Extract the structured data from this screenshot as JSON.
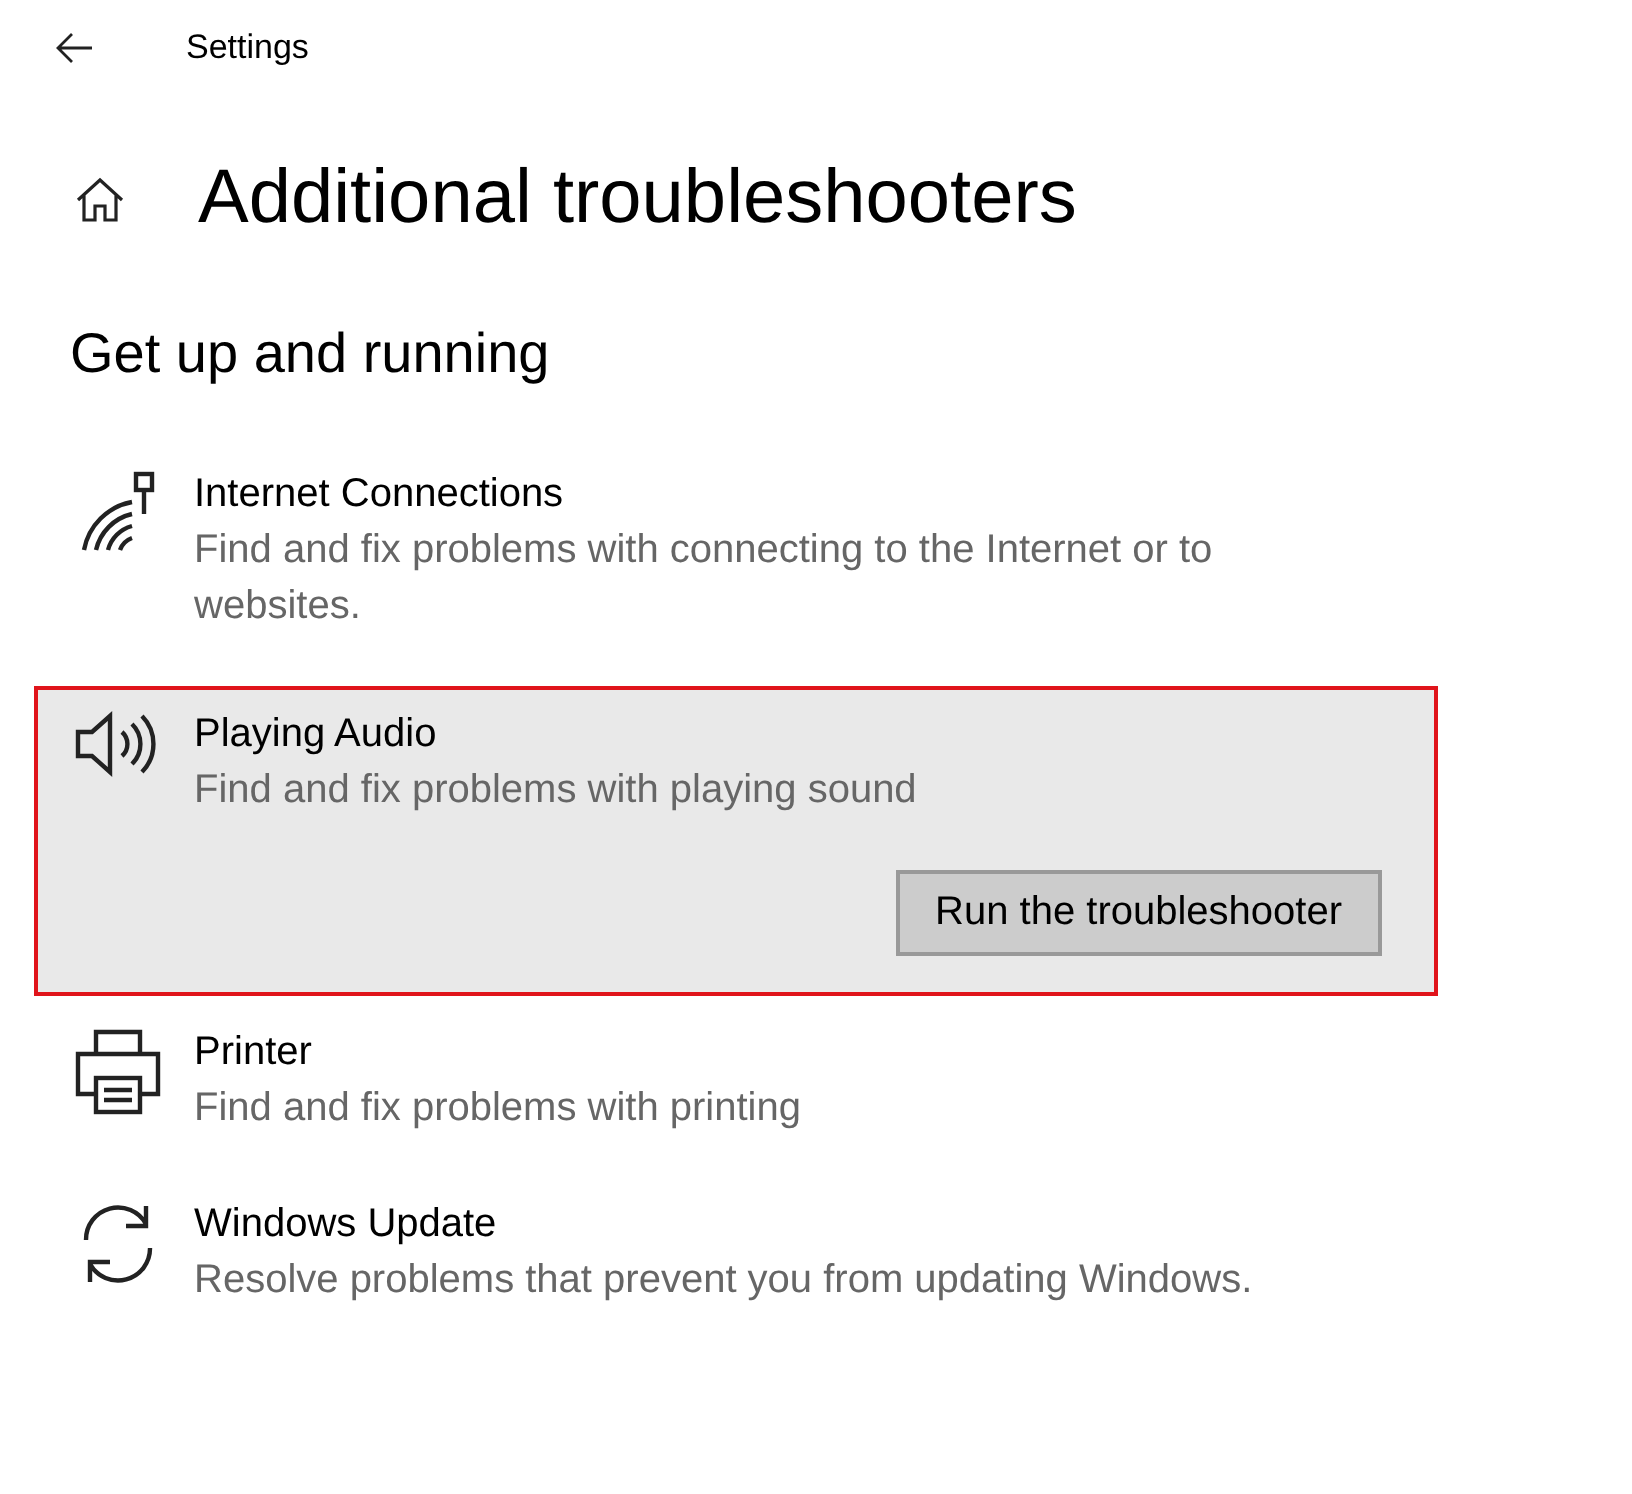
{
  "window": {
    "title": "Settings"
  },
  "page": {
    "title": "Additional troubleshooters"
  },
  "section": {
    "title": "Get up and running"
  },
  "items": [
    {
      "kind": "internet",
      "title": "Internet Connections",
      "description": "Find and fix problems with connecting to the Internet or to websites.",
      "selected": false
    },
    {
      "kind": "audio",
      "title": "Playing Audio",
      "description": "Find and fix problems with playing sound",
      "selected": true,
      "button": "Run the troubleshooter"
    },
    {
      "kind": "printer",
      "title": "Printer",
      "description": "Find and fix problems with printing",
      "selected": false
    },
    {
      "kind": "update",
      "title": "Windows Update",
      "description": "Resolve problems that prevent you from updating Windows.",
      "selected": false
    }
  ]
}
